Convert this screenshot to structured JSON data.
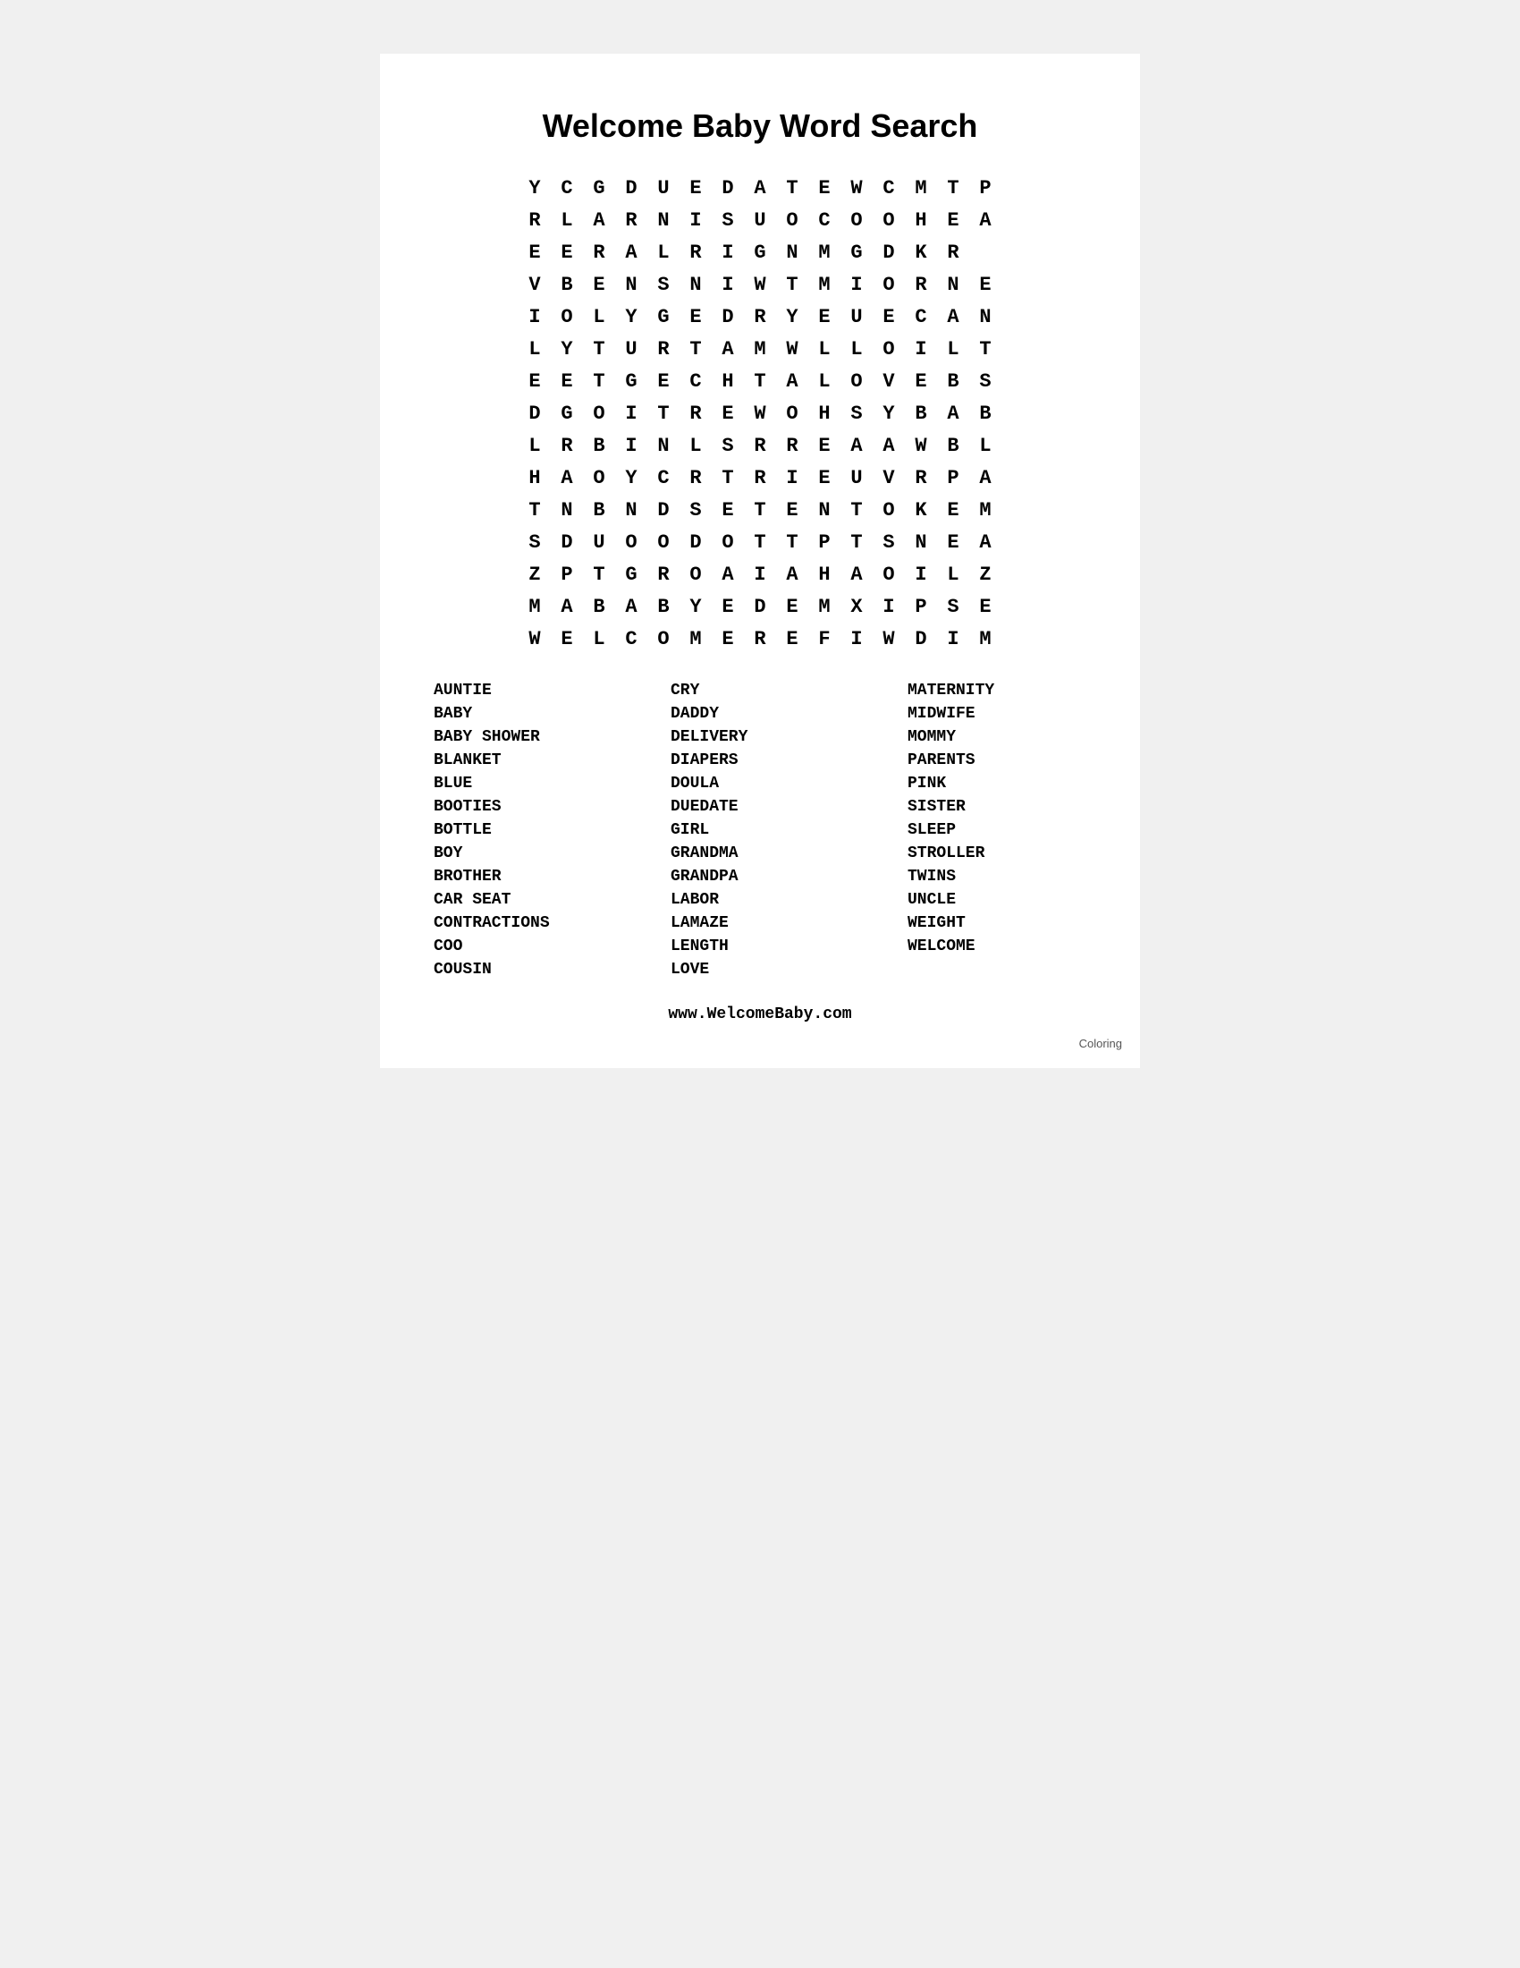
{
  "page": {
    "title": "Welcome Baby Word Search",
    "grid": [
      [
        "Y",
        "C",
        "G",
        "D",
        "U",
        "E",
        "D",
        "A",
        "T",
        "E",
        "W",
        "C",
        "M",
        "T",
        "P"
      ],
      [
        "R",
        "L",
        "A",
        "R",
        "N",
        "I",
        "S",
        "U",
        "O",
        "C",
        "O",
        "O",
        "H",
        "E",
        "A"
      ],
      [
        "E",
        "E",
        "R",
        "A",
        "L",
        "R",
        "I",
        "G",
        "N",
        "M",
        "G",
        "D",
        "K",
        "R",
        ""
      ],
      [
        "V",
        "B",
        "E",
        "N",
        "S",
        "N",
        "I",
        "W",
        "T",
        "M",
        "I",
        "O",
        "R",
        "N",
        "E"
      ],
      [
        "I",
        "O",
        "L",
        "Y",
        "G",
        "E",
        "D",
        "R",
        "Y",
        "E",
        "U",
        "E",
        "C",
        "A",
        "N"
      ],
      [
        "L",
        "Y",
        "T",
        "U",
        "R",
        "T",
        "A",
        "M",
        "W",
        "L",
        "L",
        "O",
        "I",
        "L",
        "T"
      ],
      [
        "E",
        "E",
        "T",
        "G",
        "E",
        "C",
        "H",
        "T",
        "A",
        "L",
        "O",
        "V",
        "E",
        "B",
        "S"
      ],
      [
        "D",
        "G",
        "O",
        "I",
        "T",
        "R",
        "E",
        "W",
        "O",
        "H",
        "S",
        "Y",
        "B",
        "A",
        "B"
      ],
      [
        "L",
        "R",
        "B",
        "I",
        "N",
        "L",
        "S",
        "R",
        "R",
        "E",
        "A",
        "A",
        "W",
        "B",
        "L"
      ],
      [
        "H",
        "A",
        "O",
        "Y",
        "C",
        "R",
        "T",
        "R",
        "I",
        "E",
        "U",
        "V",
        "R",
        "P",
        "A"
      ],
      [
        "T",
        "N",
        "B",
        "N",
        "D",
        "S",
        "E",
        "T",
        "E",
        "N",
        "T",
        "O",
        "K",
        "E",
        "M"
      ],
      [
        "S",
        "D",
        "U",
        "O",
        "O",
        "D",
        "O",
        "T",
        "T",
        "P",
        "T",
        "S",
        "N",
        "E",
        "A"
      ],
      [
        "Z",
        "P",
        "T",
        "G",
        "R",
        "O",
        "A",
        "I",
        "A",
        "H",
        "A",
        "O",
        "I",
        "L",
        "Z"
      ],
      [
        "M",
        "A",
        "B",
        "A",
        "B",
        "Y",
        "E",
        "D",
        "E",
        "M",
        "X",
        "I",
        "P",
        "S",
        "E"
      ],
      [
        "W",
        "E",
        "L",
        "C",
        "O",
        "M",
        "E",
        "R",
        "E",
        "F",
        "I",
        "W",
        "D",
        "I",
        "M"
      ]
    ],
    "word_list": {
      "col1": [
        "AUNTIE",
        "BABY",
        "BABY SHOWER",
        "BLANKET",
        "BLUE",
        "BOOTIES",
        "BOTTLE",
        "BOY",
        "BROTHER",
        "CAR SEAT",
        "CONTRACTIONS",
        "COO",
        "COUSIN"
      ],
      "col2": [
        "CRY",
        "DADDY",
        "DELIVERY",
        "DIAPERS",
        "DOULA",
        "DUEDATE",
        "GIRL",
        "GRANDMA",
        "GRANDPA",
        "LABOR",
        "LAMAZE",
        "LENGTH",
        "LOVE"
      ],
      "col3": [
        "MATERNITY",
        "MIDWIFE",
        "MOMMY",
        "PARENTS",
        "PINK",
        "SISTER",
        "SLEEP",
        "STROLLER",
        "TWINS",
        "UNCLE",
        "WEIGHT",
        "WELCOME"
      ]
    },
    "footer_url": "www.WelcomeBaby.com",
    "coloring_label": "Coloring"
  }
}
